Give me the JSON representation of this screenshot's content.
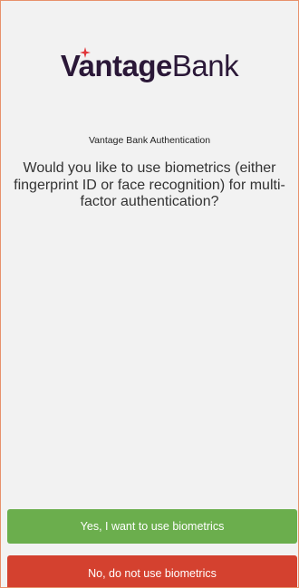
{
  "brand": {
    "name_primary": "Vantage",
    "name_secondary": "Bank",
    "color": "#2b1838",
    "star_color": "#e0363a"
  },
  "auth": {
    "label": "Vantage Bank Authentication",
    "question": "Would you like to use biometrics (either fingerprint ID or face recognition) for multi-factor authentication?"
  },
  "buttons": {
    "yes_label": "Yes, I want to use biometrics",
    "no_label": "No, do not use biometrics",
    "yes_color": "#6bae4d",
    "no_color": "#d4412f"
  }
}
